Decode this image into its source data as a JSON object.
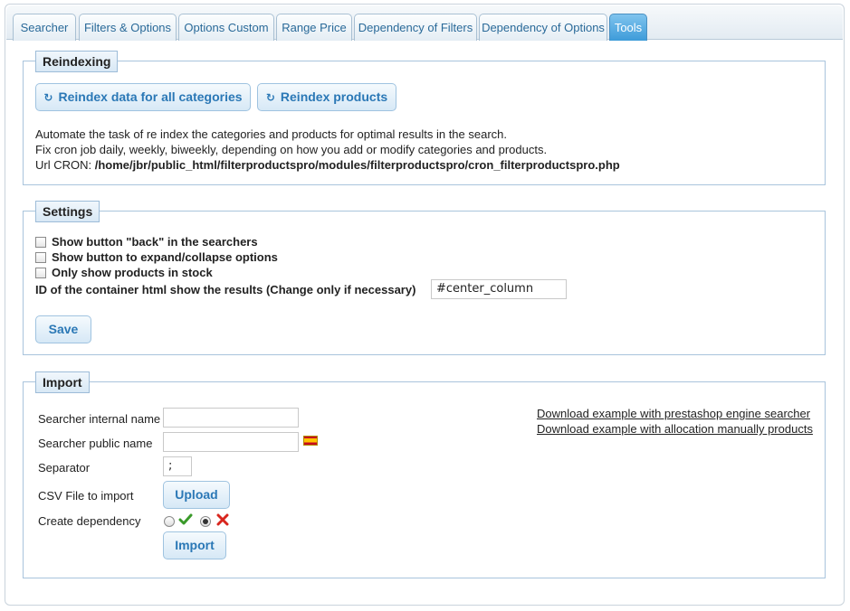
{
  "tabs": [
    {
      "label": "Searcher",
      "active": false
    },
    {
      "label": "Filters & Options",
      "active": false
    },
    {
      "label": "Options Custom",
      "active": false
    },
    {
      "label": "Range Price",
      "active": false
    },
    {
      "label": "Dependency of Filters",
      "active": false
    },
    {
      "label": "Dependency of Options",
      "active": false
    },
    {
      "label": "Tools",
      "active": true
    }
  ],
  "reindexing": {
    "legend": "Reindexing",
    "btn_categories": "Reindex data for all categories",
    "btn_products": "Reindex products",
    "icon": "refresh-icon",
    "desc_line1": "Automate the task of re index the categories and products for optimal results in the search.",
    "desc_line2": "Fix cron job daily, weekly, biweekly, depending on how you add or modify categories and products.",
    "cron_label": "Url CRON:",
    "cron_url": "/home/jbr/public_html/filterproductspro/modules/filterproductspro/cron_filterproductspro.php"
  },
  "settings": {
    "legend": "Settings",
    "opt_back": "Show button \"back\" in the searchers",
    "opt_expand": "Show button to expand/collapse options",
    "opt_stock": "Only show products in stock",
    "container_label": "ID of the container html show the results (Change only if necessary)",
    "container_value": "#center_column",
    "save": "Save"
  },
  "import": {
    "legend": "Import",
    "internal_label": "Searcher internal name",
    "internal_value": "",
    "public_label": "Searcher public name",
    "public_value": "",
    "flag": "spain-flag-icon",
    "separator_label": "Separator",
    "separator_value": ";",
    "csv_label": "CSV File to import",
    "upload": "Upload",
    "dependency_label": "Create dependency",
    "dependency_selected": "no",
    "import_btn": "Import",
    "link1": "Download example with prestashop engine searcher",
    "link2": "Download example with allocation manually products"
  },
  "colors": {
    "accent": "#2b78b6",
    "active_tab": "#3d9bd9",
    "check_green": "#3a9a2a",
    "cross_red": "#d8261e"
  }
}
